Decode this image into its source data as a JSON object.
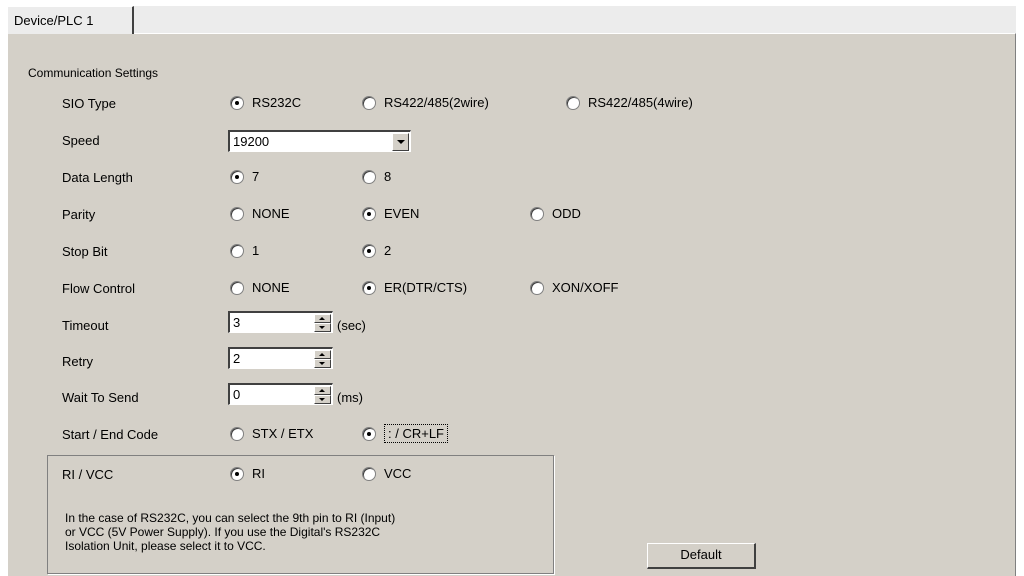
{
  "tab": {
    "label": "Device/PLC 1"
  },
  "section_title": "Communication Settings",
  "rows": {
    "sio_type": {
      "label": "SIO Type",
      "options": [
        "RS232C",
        "RS422/485(2wire)",
        "RS422/485(4wire)"
      ],
      "selected": 0
    },
    "speed": {
      "label": "Speed",
      "value": "19200"
    },
    "data_length": {
      "label": "Data Length",
      "options": [
        "7",
        "8"
      ],
      "selected": 0
    },
    "parity": {
      "label": "Parity",
      "options": [
        "NONE",
        "EVEN",
        "ODD"
      ],
      "selected": 1
    },
    "stop_bit": {
      "label": "Stop Bit",
      "options": [
        "1",
        "2"
      ],
      "selected": 1
    },
    "flow_control": {
      "label": "Flow Control",
      "options": [
        "NONE",
        "ER(DTR/CTS)",
        "XON/XOFF"
      ],
      "selected": 1
    },
    "timeout": {
      "label": "Timeout",
      "value": "3",
      "unit": "(sec)"
    },
    "retry": {
      "label": "Retry",
      "value": "2"
    },
    "wait_to_send": {
      "label": "Wait To Send",
      "value": "0",
      "unit": "(ms)"
    },
    "start_end_code": {
      "label": "Start / End Code",
      "options": [
        "STX / ETX",
        ": / CR+LF"
      ],
      "selected": 1
    }
  },
  "ri_vcc": {
    "label": "RI / VCC",
    "options": [
      "RI",
      "VCC"
    ],
    "selected": 0,
    "help": [
      "In the case of RS232C, you can select the 9th pin to RI (Input)",
      "or VCC (5V Power Supply). If you use the Digital's RS232C",
      "Isolation Unit, please select it to VCC."
    ]
  },
  "default_button": "Default"
}
